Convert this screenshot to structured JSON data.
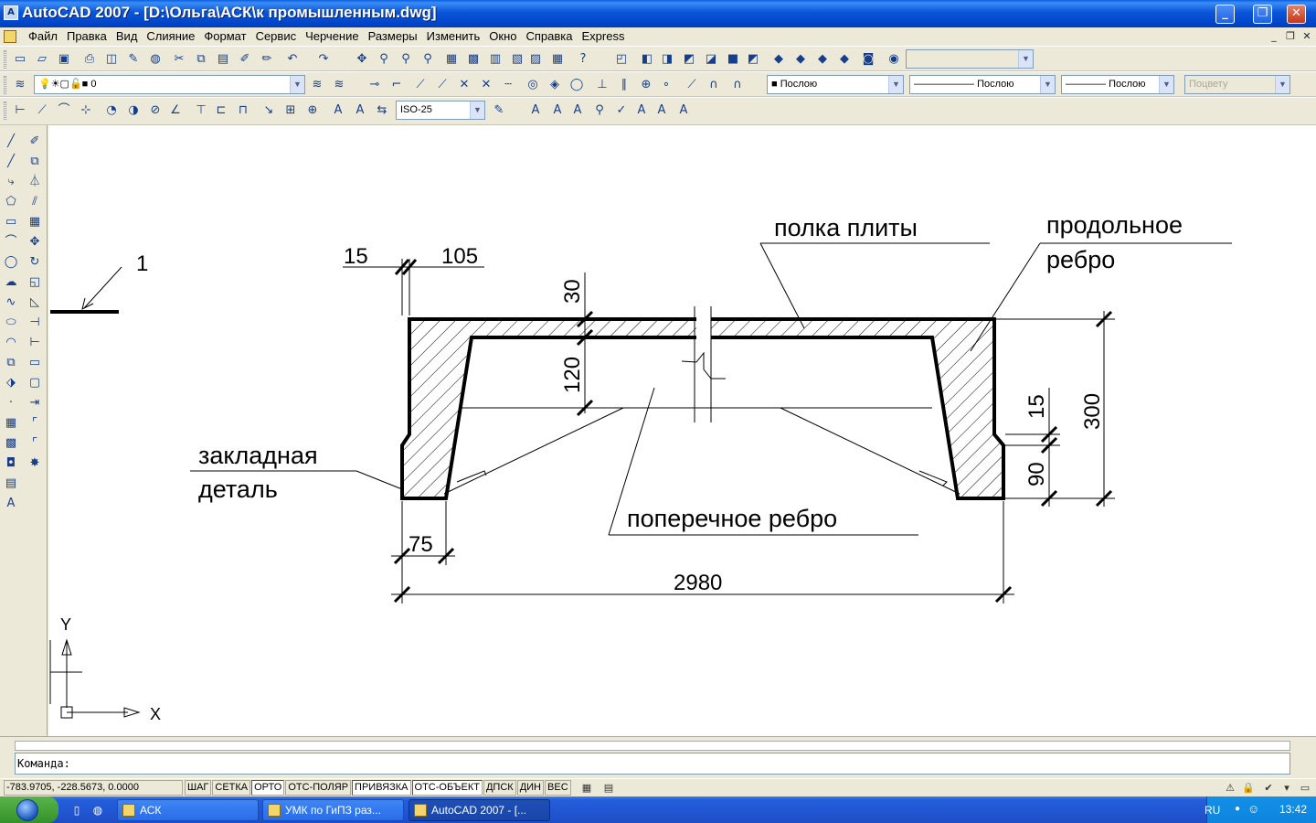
{
  "window": {
    "icon": "autocad-app-icon",
    "title": "AutoCAD 2007 - [D:\\Ольга\\АСК\\к промышленным.dwg]",
    "buttons": [
      "minimize",
      "restore",
      "close"
    ]
  },
  "menubar": {
    "items": [
      "Файл",
      "Правка",
      "Вид",
      "Слияние",
      "Формат",
      "Сервис",
      "Черчение",
      "Размеры",
      "Изменить",
      "Окно",
      "Справка",
      "Express"
    ],
    "mdi_buttons": [
      "minimize",
      "restore",
      "close"
    ]
  },
  "toolbar_row2": {
    "layer_name": "0",
    "color_combo": "Послою",
    "linetype_combo": "Послою",
    "lineweight_combo": "Послою",
    "plotstyle_combo": "Поцвету"
  },
  "toolbar_row3": {
    "dimstyle_combo": "ISO-25"
  },
  "drawing": {
    "leader_callout": "1",
    "dim_15_top": "15",
    "dim_105": "105",
    "dim_30": "30",
    "dim_120": "120",
    "dim_15_right": "15",
    "dim_90": "90",
    "dim_300": "300",
    "dim_75": "75",
    "dim_2980": "2980",
    "label_flange": "полка плиты",
    "label_long_rib_1": "продольное",
    "label_long_rib_2": "ребро",
    "label_embed_1": "закладная",
    "label_embed_2": "деталь",
    "label_cross_rib": "поперечное ребро",
    "ucs_x": "X",
    "ucs_y": "Y"
  },
  "command": {
    "prompt": "Команда:"
  },
  "statusbar": {
    "coordinates": "-783.9705, -228.5673, 0.0000",
    "toggles": [
      {
        "label": "ШАГ",
        "on": false
      },
      {
        "label": "СЕТКА",
        "on": false
      },
      {
        "label": "ОРТО",
        "on": true
      },
      {
        "label": "ОТС-ПОЛЯР",
        "on": false
      },
      {
        "label": "ПРИВЯЗКА",
        "on": true
      },
      {
        "label": "ОТС-ОБЪЕКТ",
        "on": true
      },
      {
        "label": "ДПСК",
        "on": false
      },
      {
        "label": "ДИН",
        "on": false
      },
      {
        "label": "ВЕС",
        "on": false
      }
    ]
  },
  "taskbar": {
    "tasks": [
      {
        "label": "АСК",
        "active": false
      },
      {
        "label": "УМК по ГиПЗ  раз...",
        "active": false
      },
      {
        "label": "AutoCAD 2007 - [...",
        "active": true
      }
    ],
    "language": "RU",
    "clock": "13:42"
  },
  "colors": {
    "title_bar": "#0a54d8",
    "taskbar": "#245edb",
    "canvas": "#ffffff",
    "drawing_stroke": "#000000"
  }
}
